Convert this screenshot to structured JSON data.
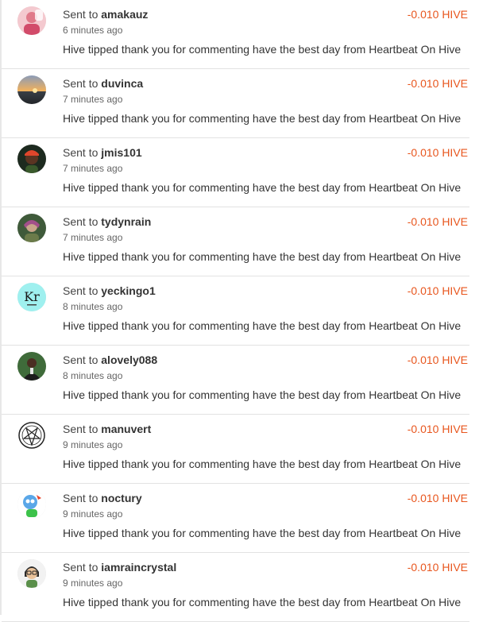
{
  "colors": {
    "amount": "#e8561e",
    "divider": "#e2e2e2",
    "text": "#333333",
    "muted": "#666666"
  },
  "transactions": [
    {
      "prefix": "Sent to",
      "user": "amakauz",
      "time": "6 minutes ago",
      "memo": "Hive tipped thank you for commenting have the best day from Heartbeat On Hive",
      "amount": "-0.010 HIVE",
      "avatar_icon": "avatar-amakauz-icon"
    },
    {
      "prefix": "Sent to",
      "user": "duvinca",
      "time": "7 minutes ago",
      "memo": "Hive tipped thank you for commenting have the best day from Heartbeat On Hive",
      "amount": "-0.010 HIVE",
      "avatar_icon": "avatar-duvinca-icon"
    },
    {
      "prefix": "Sent to",
      "user": "jmis101",
      "time": "7 minutes ago",
      "memo": "Hive tipped thank you for commenting have the best day from Heartbeat On Hive",
      "amount": "-0.010 HIVE",
      "avatar_icon": "avatar-jmis101-icon"
    },
    {
      "prefix": "Sent to",
      "user": "tydynrain",
      "time": "7 minutes ago",
      "memo": "Hive tipped thank you for commenting have the best day from Heartbeat On Hive",
      "amount": "-0.010 HIVE",
      "avatar_icon": "avatar-tydynrain-icon"
    },
    {
      "prefix": "Sent to",
      "user": "yeckingo1",
      "time": "8 minutes ago",
      "memo": "Hive tipped thank you for commenting have the best day from Heartbeat On Hive",
      "amount": "-0.010 HIVE",
      "avatar_icon": "avatar-yeckingo1-icon",
      "avatar_text": "Kr"
    },
    {
      "prefix": "Sent to",
      "user": "alovely088",
      "time": "8 minutes ago",
      "memo": "Hive tipped thank you for commenting have the best day from Heartbeat On Hive",
      "amount": "-0.010 HIVE",
      "avatar_icon": "avatar-alovely088-icon"
    },
    {
      "prefix": "Sent to",
      "user": "manuvert",
      "time": "9 minutes ago",
      "memo": "Hive tipped thank you for commenting have the best day from Heartbeat On Hive",
      "amount": "-0.010 HIVE",
      "avatar_icon": "avatar-manuvert-icon"
    },
    {
      "prefix": "Sent to",
      "user": "noctury",
      "time": "9 minutes ago",
      "memo": "Hive tipped thank you for commenting have the best day from Heartbeat On Hive",
      "amount": "-0.010 HIVE",
      "avatar_icon": "avatar-noctury-icon"
    },
    {
      "prefix": "Sent to",
      "user": "iamraincrystal",
      "time": "9 minutes ago",
      "memo": "Hive tipped thank you for commenting have the best day from Heartbeat On Hive",
      "amount": "-0.010 HIVE",
      "avatar_icon": "avatar-iamraincrystal-icon"
    }
  ]
}
